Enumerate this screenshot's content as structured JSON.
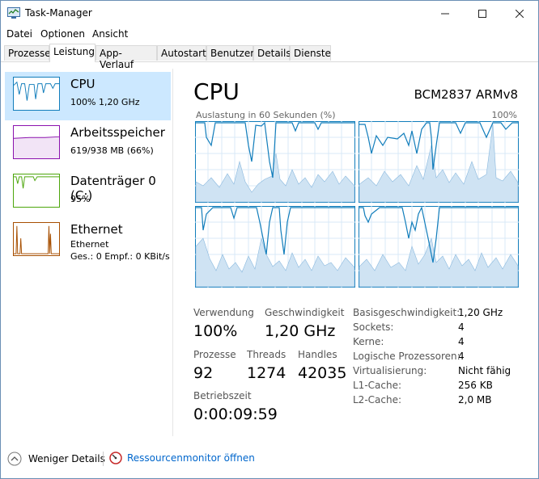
{
  "window": {
    "title": "Task-Manager"
  },
  "menu": [
    "Datei",
    "Optionen",
    "Ansicht"
  ],
  "tabs": [
    "Prozesse",
    "Leistung",
    "App-Verlauf",
    "Autostart",
    "Benutzer",
    "Details",
    "Dienste"
  ],
  "sidebar": {
    "cpu": {
      "name": "CPU",
      "sub": "100% 1,20 GHz"
    },
    "memory": {
      "name": "Arbeitsspeicher",
      "sub": "619/938 MB (66%)"
    },
    "disk": {
      "name": "Datenträger 0 (C:)",
      "sub": "95%"
    },
    "ethernet": {
      "name": "Ethernet",
      "sub1": "Ethernet",
      "sub2": "Ges.: 0 Empf.: 0 KBit/s"
    }
  },
  "main": {
    "title": "CPU",
    "model": "BCM2837 ARMv8",
    "graph_caption": "Auslastung in 60 Sekunden (%)",
    "graph_max": "100%"
  },
  "stats": {
    "utilization": {
      "label": "Verwendung",
      "value": "100%"
    },
    "speed": {
      "label": "Geschwindigkeit",
      "value": "1,20 GHz"
    },
    "processes": {
      "label": "Prozesse",
      "value": "92"
    },
    "threads": {
      "label": "Threads",
      "value": "1274"
    },
    "handles": {
      "label": "Handles",
      "value": "42035"
    },
    "uptime": {
      "label": "Betriebszeit",
      "value": "0:00:09:59"
    }
  },
  "info": [
    {
      "label": "Basisgeschwindigkeit:",
      "value": "1,20 GHz"
    },
    {
      "label": "Sockets:",
      "value": "4"
    },
    {
      "label": "Kerne:",
      "value": "4"
    },
    {
      "label": "Logische Prozessoren:",
      "value": "4"
    },
    {
      "label": "Virtualisierung:",
      "value": "Nicht fähig"
    },
    {
      "label": "L1-Cache:",
      "value": "256 KB"
    },
    {
      "label": "L2-Cache:",
      "value": "2,0 MB"
    }
  ],
  "footer": {
    "fewer_details": "Weniger Details",
    "resource_monitor": "Ressourcenmonitor öffnen"
  },
  "colors": {
    "cpu": "#117dbb",
    "memory": "#8b12ae",
    "disk": "#4da60c",
    "ethernet": "#a74f01",
    "selected": "#cce8ff",
    "link": "#0066cc"
  }
}
